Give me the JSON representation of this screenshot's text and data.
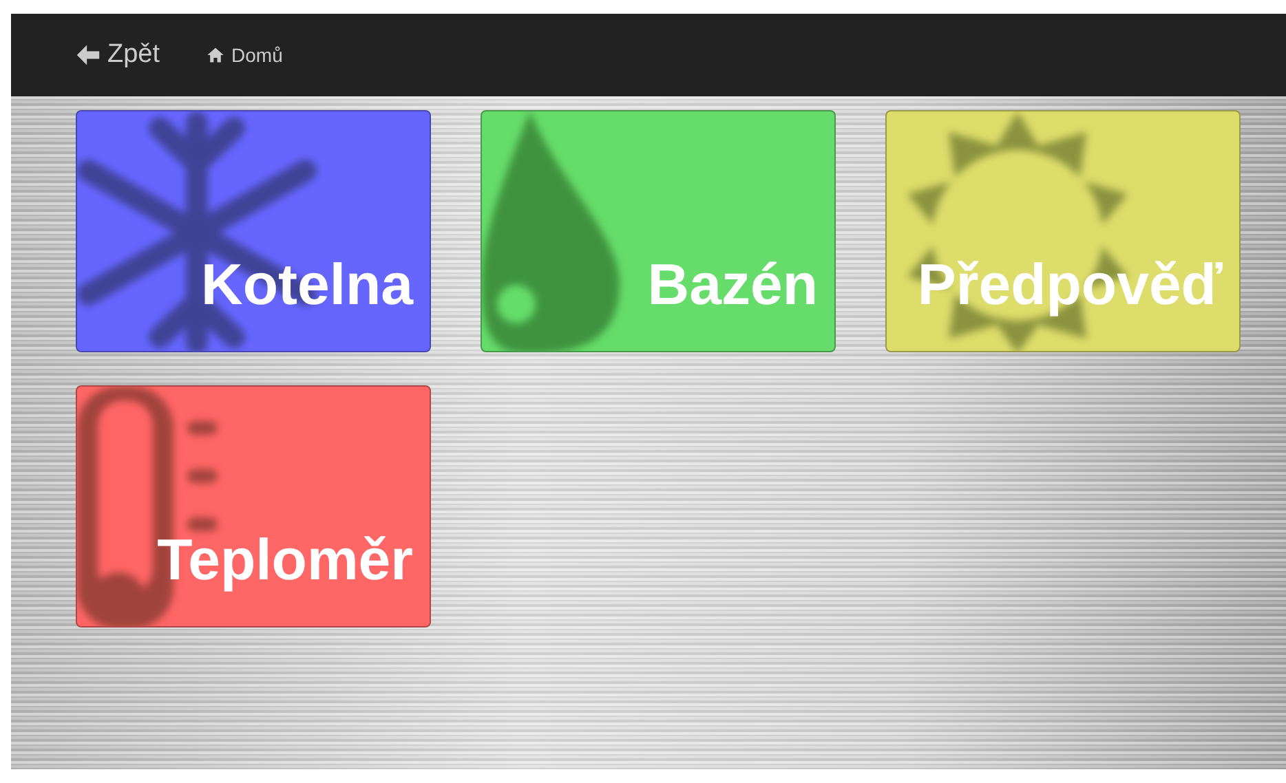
{
  "nav": {
    "back": {
      "label": "Zpět"
    },
    "home": {
      "label": "Domů"
    }
  },
  "tiles": [
    {
      "label": "Kotelna",
      "kind": "snowflake",
      "color": "#6666ff"
    },
    {
      "label": "Bazén",
      "kind": "drop",
      "color": "#66dd6b"
    },
    {
      "label": "Předpověď",
      "kind": "sun",
      "color": "#dddd6b"
    },
    {
      "label": "Teploměr",
      "kind": "thermometer",
      "color": "#ff6666"
    }
  ]
}
